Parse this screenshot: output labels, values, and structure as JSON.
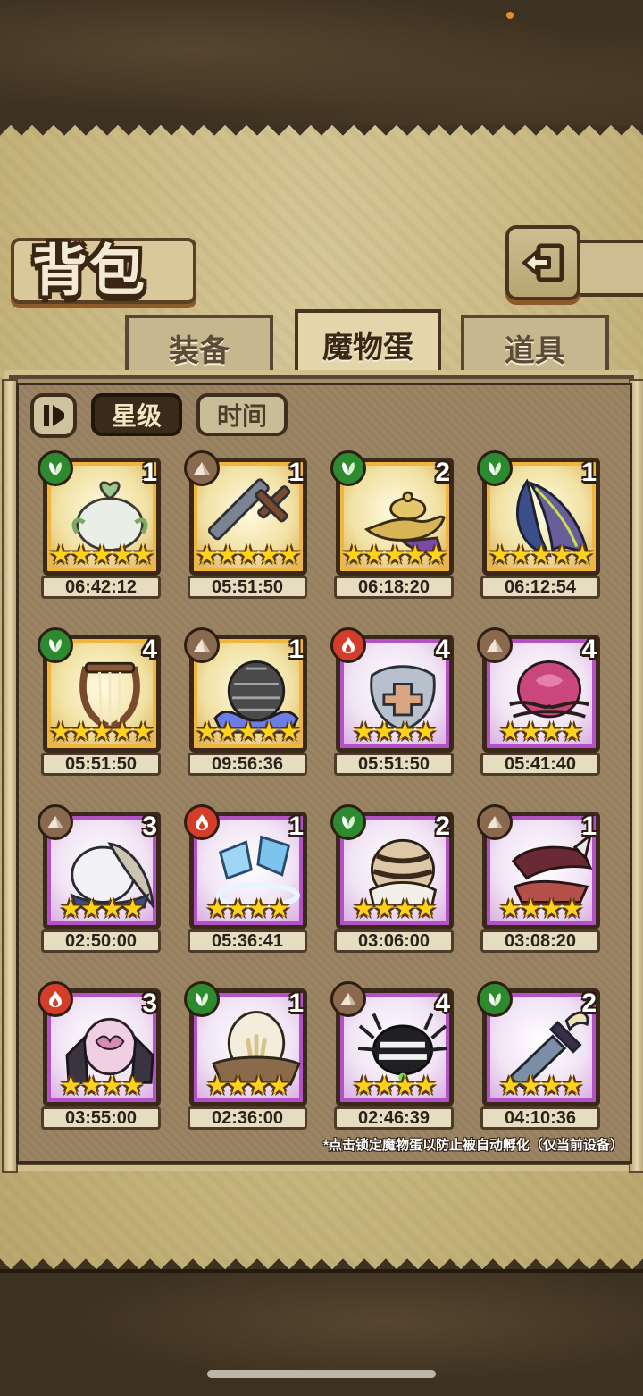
{
  "header": {
    "title": "背包"
  },
  "tabs": [
    {
      "label": "装备",
      "active": false
    },
    {
      "label": "魔物蛋",
      "active": true
    },
    {
      "label": "道具",
      "active": false
    }
  ],
  "sort": {
    "star_label": "星级",
    "time_label": "时间",
    "active": "星级"
  },
  "element_icons": {
    "grass": "leaf-icon",
    "earth": "mountain-icon",
    "fire": "flame-icon"
  },
  "colors": {
    "rare_frame": "#f0b53c",
    "epic_frame": "#b352c6",
    "grass": "#2d8a2f",
    "earth": "#8a6a4f",
    "fire": "#d33d2a"
  },
  "eggs": [
    {
      "element": "grass",
      "frame": "gold",
      "stars": 5,
      "count": "1",
      "timer": "06:42:12",
      "art": "sprout-egg"
    },
    {
      "element": "earth",
      "frame": "gold",
      "stars": 5,
      "count": "1",
      "timer": "05:51:50",
      "art": "sword"
    },
    {
      "element": "grass",
      "frame": "gold",
      "stars": 5,
      "count": "2",
      "timer": "06:18:20",
      "art": "magic-lamp"
    },
    {
      "element": "grass",
      "frame": "gold",
      "stars": 5,
      "count": "1",
      "timer": "06:12:54",
      "art": "wing"
    },
    {
      "element": "grass",
      "frame": "gold",
      "stars": 5,
      "count": "4",
      "timer": "05:51:50",
      "art": "lyre"
    },
    {
      "element": "earth",
      "frame": "gold",
      "stars": 5,
      "count": "1",
      "timer": "09:56:36",
      "art": "pinecone-egg"
    },
    {
      "element": "fire",
      "frame": "purple",
      "stars": 4,
      "count": "4",
      "timer": "05:51:50",
      "art": "shield"
    },
    {
      "element": "earth",
      "frame": "purple",
      "stars": 4,
      "count": "4",
      "timer": "05:41:40",
      "art": "thorn-egg"
    },
    {
      "element": "earth",
      "frame": "purple",
      "stars": 4,
      "count": "3",
      "timer": "02:50:00",
      "art": "feather-egg"
    },
    {
      "element": "fire",
      "frame": "purple",
      "stars": 4,
      "count": "1",
      "timer": "05:36:41",
      "art": "ice-crystal"
    },
    {
      "element": "grass",
      "frame": "purple",
      "stars": 4,
      "count": "2",
      "timer": "03:06:00",
      "art": "tiger-egg"
    },
    {
      "element": "earth",
      "frame": "purple",
      "stars": 4,
      "count": "1",
      "timer": "03:08:20",
      "art": "horn"
    },
    {
      "element": "fire",
      "frame": "purple",
      "stars": 4,
      "count": "3",
      "timer": "03:55:00",
      "art": "demon-egg"
    },
    {
      "element": "grass",
      "frame": "purple",
      "stars": 4,
      "count": "1",
      "timer": "02:36:00",
      "art": "nest-egg"
    },
    {
      "element": "earth",
      "frame": "purple",
      "stars": 4,
      "count": "4",
      "timer": "02:46:39",
      "art": "spider-egg"
    },
    {
      "element": "grass",
      "frame": "purple",
      "stars": 4,
      "count": "2",
      "timer": "04:10:36",
      "art": "dagger"
    }
  ],
  "hint_text": "*点击锁定魔物蛋以防止被自动孵化（仅当前设备）"
}
